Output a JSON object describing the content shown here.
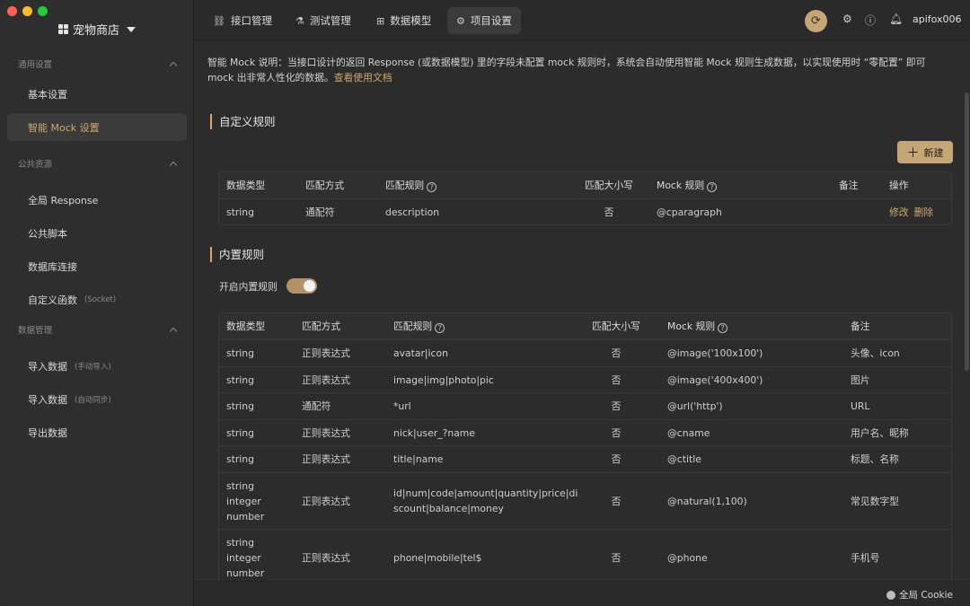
{
  "window": {
    "controls": {
      "close": "#ff5f57",
      "minimize": "#febc2e",
      "maximize": "#28c840"
    }
  },
  "sidebar": {
    "project": "宠物商店",
    "groups": [
      {
        "title": "通用设置",
        "items": [
          {
            "label": "基本设置",
            "sub": ""
          },
          {
            "label": "智能 Mock 设置",
            "sub": "",
            "active": true
          }
        ]
      },
      {
        "title": "公共资源",
        "items": [
          {
            "label": "全局 Response",
            "sub": ""
          },
          {
            "label": "公共脚本",
            "sub": ""
          },
          {
            "label": "数据库连接",
            "sub": ""
          },
          {
            "label": "自定义函数",
            "sub": "(Socket)"
          }
        ]
      },
      {
        "title": "数据管理",
        "items": [
          {
            "label": "导入数据",
            "sub": "(手动导入)"
          },
          {
            "label": "导入数据",
            "sub": "(自动同步)"
          },
          {
            "label": "导出数据",
            "sub": ""
          }
        ]
      }
    ]
  },
  "topbar": {
    "tabs": [
      {
        "label": "接口管理",
        "icon": "link-icon"
      },
      {
        "label": "测试管理",
        "icon": "flask-icon"
      },
      {
        "label": "数据模型",
        "icon": "model-icon"
      },
      {
        "label": "项目设置",
        "icon": "gear-icon",
        "active": true
      }
    ],
    "user": "apifox006"
  },
  "main": {
    "description": "智能 Mock 说明：当接口设计的返回 Response (或数据模型) 里的字段未配置 mock 规则时，系统会自动使用智能 Mock 规则生成数据，以实现使用时 “零配置” 即可 mock 出非常人性化的数据。",
    "doc_link": "查看使用文档",
    "custom_section": {
      "title": "自定义规则",
      "new_button": "新建",
      "headers": [
        "数据类型",
        "匹配方式",
        "匹配规则",
        "匹配大小写",
        "Mock 规则",
        "备注",
        "操作"
      ],
      "rows": [
        {
          "type": "string",
          "match": "通配符",
          "rule": "description",
          "case": "否",
          "mock": "@cparagraph",
          "note": "",
          "edit": "修改",
          "delete": "删除"
        }
      ]
    },
    "builtin_section": {
      "title": "内置规则",
      "toggle_label": "开启内置规则",
      "toggle_on": true,
      "headers": [
        "数据类型",
        "匹配方式",
        "匹配规则",
        "匹配大小写",
        "Mock 规则",
        "备注"
      ],
      "rows": [
        {
          "type": [
            "string"
          ],
          "match": "正则表达式",
          "rule": [
            "avatar|icon"
          ],
          "case": "否",
          "mock": "@image('100x100')",
          "note": "头像、icon"
        },
        {
          "type": [
            "string"
          ],
          "match": "正则表达式",
          "rule": [
            "image|img|photo|pic"
          ],
          "case": "否",
          "mock": "@image('400x400')",
          "note": "图片"
        },
        {
          "type": [
            "string"
          ],
          "match": "通配符",
          "rule": [
            "*url"
          ],
          "case": "否",
          "mock": "@url('http')",
          "note": "URL"
        },
        {
          "type": [
            "string"
          ],
          "match": "正则表达式",
          "rule": [
            "nick|user_?name"
          ],
          "case": "否",
          "mock": "@cname",
          "note": "用户名、昵称"
        },
        {
          "type": [
            "string"
          ],
          "match": "正则表达式",
          "rule": [
            "title|name"
          ],
          "case": "否",
          "mock": "@ctitle",
          "note": "标题、名称"
        },
        {
          "type": [
            "string",
            "integer",
            "number"
          ],
          "match": "正则表达式",
          "rule": [
            "id|num|code|amount|quantity|price|di",
            "scount|balance|money"
          ],
          "case": "否",
          "mock": "@natural(1,100)",
          "note": "常见数字型"
        },
        {
          "type": [
            "string",
            "integer",
            "number"
          ],
          "match": "正则表达式",
          "rule": [
            "phone|mobile|tel$"
          ],
          "case": "否",
          "mock": "@phone",
          "note": "手机号"
        }
      ]
    }
  },
  "footer": {
    "cookie": "全局 Cookie"
  },
  "colors": {
    "accent": "#cfa872",
    "button": "#c5a676",
    "background": "#2c2c2c"
  }
}
